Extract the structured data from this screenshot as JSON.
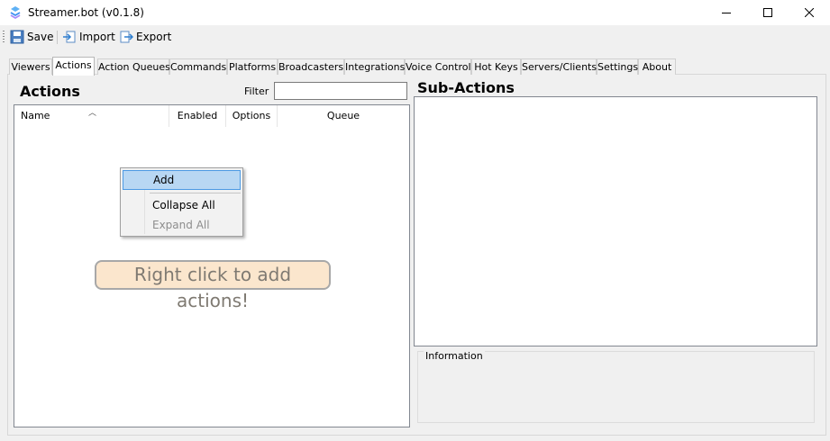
{
  "window": {
    "title": "Streamer.bot (v0.1.8)",
    "controls": [
      "minimize-icon",
      "maximize-icon",
      "close-icon"
    ]
  },
  "toolbar": {
    "save_label": "Save",
    "import_label": "Import",
    "export_label": "Export"
  },
  "tabs": [
    {
      "label": "Viewers",
      "active": false
    },
    {
      "label": "Actions",
      "active": true
    },
    {
      "label": "Action Queues",
      "active": false
    },
    {
      "label": "Commands",
      "active": false
    },
    {
      "label": "Platforms",
      "active": false
    },
    {
      "label": "Broadcasters",
      "active": false
    },
    {
      "label": "Integrations",
      "active": false
    },
    {
      "label": "Voice Control",
      "active": false
    },
    {
      "label": "Hot Keys",
      "active": false
    },
    {
      "label": "Servers/Clients",
      "active": false
    },
    {
      "label": "Settings",
      "active": false
    },
    {
      "label": "About",
      "active": false
    }
  ],
  "actions_panel": {
    "title": "Actions",
    "filter_label": "Filter",
    "filter_value": "",
    "columns": [
      "Name",
      "Enabled",
      "Options",
      "Queue"
    ],
    "sorted_column": "Name",
    "empty_hint": "Right click to add actions!"
  },
  "context_menu": {
    "items": [
      {
        "label": "Add",
        "highlighted": true,
        "enabled": true
      },
      {
        "label": "Collapse All",
        "highlighted": false,
        "enabled": true
      },
      {
        "label": "Expand All",
        "highlighted": false,
        "enabled": false
      }
    ]
  },
  "subactions_panel": {
    "title": "Sub-Actions"
  },
  "information": {
    "label": "Information"
  },
  "colors": {
    "window_bg": "#f0f0f0",
    "menu_highlight": "#b8d7f3",
    "menu_highlight_border": "#4c9ae4",
    "hint_bg": "#fbe6cd",
    "app_icon": "#3b8ff0"
  }
}
